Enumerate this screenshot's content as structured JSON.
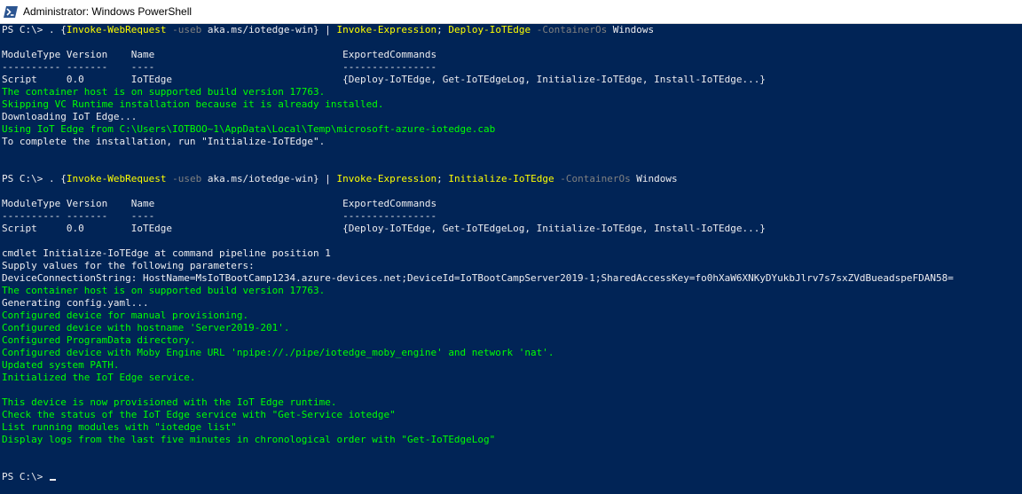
{
  "window": {
    "title": "Administrator: Windows PowerShell",
    "icon": "powershell-icon"
  },
  "colors": {
    "background": "#012456",
    "text": "#eeedf0",
    "command": "#ffff00",
    "parameter": "#808080",
    "success": "#00ff00"
  },
  "console": {
    "lines": [
      [
        {
          "t": "PS C:\\> . {"
        },
        {
          "t": "Invoke-WebRequest",
          "c": "cmd"
        },
        {
          "t": " -useb",
          "c": "param"
        },
        {
          "t": " aka.ms/iotedge-win} | "
        },
        {
          "t": "Invoke-Expression",
          "c": "cmd"
        },
        {
          "t": "; "
        },
        {
          "t": "Deploy-IoTEdge",
          "c": "cmd"
        },
        {
          "t": " -ContainerOs",
          "c": "param"
        },
        {
          "t": " Windows"
        }
      ],
      [
        {
          "t": ""
        }
      ],
      [
        {
          "t": "ModuleType Version    Name                                ExportedCommands"
        }
      ],
      [
        {
          "t": "---------- -------    ----                                ----------------"
        }
      ],
      [
        {
          "t": "Script     0.0        IoTEdge                             {Deploy-IoTEdge, Get-IoTEdgeLog, Initialize-IoTEdge, Install-IoTEdge...}"
        }
      ],
      [
        {
          "t": "The container host is on supported build version 17763.",
          "c": "ok"
        }
      ],
      [
        {
          "t": "Skipping VC Runtime installation because it is already installed.",
          "c": "ok"
        }
      ],
      [
        {
          "t": "Downloading IoT Edge..."
        }
      ],
      [
        {
          "t": "Using IoT Edge from C:\\Users\\IOTBOO~1\\AppData\\Local\\Temp\\microsoft-azure-iotedge.cab",
          "c": "ok"
        }
      ],
      [
        {
          "t": "To complete the installation, run \"Initialize-IoTEdge\"."
        }
      ],
      [
        {
          "t": ""
        }
      ],
      [
        {
          "t": ""
        }
      ],
      [
        {
          "t": "PS C:\\> . {"
        },
        {
          "t": "Invoke-WebRequest",
          "c": "cmd"
        },
        {
          "t": " -useb",
          "c": "param"
        },
        {
          "t": " aka.ms/iotedge-win} | "
        },
        {
          "t": "Invoke-Expression",
          "c": "cmd"
        },
        {
          "t": "; "
        },
        {
          "t": "Initialize-IoTEdge",
          "c": "cmd"
        },
        {
          "t": " -ContainerOs",
          "c": "param"
        },
        {
          "t": " Windows"
        }
      ],
      [
        {
          "t": ""
        }
      ],
      [
        {
          "t": "ModuleType Version    Name                                ExportedCommands"
        }
      ],
      [
        {
          "t": "---------- -------    ----                                ----------------"
        }
      ],
      [
        {
          "t": "Script     0.0        IoTEdge                             {Deploy-IoTEdge, Get-IoTEdgeLog, Initialize-IoTEdge, Install-IoTEdge...}"
        }
      ],
      [
        {
          "t": ""
        }
      ],
      [
        {
          "t": "cmdlet Initialize-IoTEdge at command pipeline position 1"
        }
      ],
      [
        {
          "t": "Supply values for the following parameters:"
        }
      ],
      [
        {
          "t": "DeviceConnectionString: HostName=MsIoTBootCamp1234.azure-devices.net;DeviceId=IoTBootCampServer2019-1;SharedAccessKey=fo0hXaW6XNKyDYukbJlrv7s7sxZVdBueadspeFDAN58="
        }
      ],
      [
        {
          "t": "The container host is on supported build version 17763.",
          "c": "ok"
        }
      ],
      [
        {
          "t": "Generating config.yaml..."
        }
      ],
      [
        {
          "t": "Configured device for manual provisioning.",
          "c": "ok"
        }
      ],
      [
        {
          "t": "Configured device with hostname 'Server2019-201'.",
          "c": "ok"
        }
      ],
      [
        {
          "t": "Configured ProgramData directory.",
          "c": "ok"
        }
      ],
      [
        {
          "t": "Configured device with Moby Engine URL 'npipe://./pipe/iotedge_moby_engine' and network 'nat'.",
          "c": "ok"
        }
      ],
      [
        {
          "t": "Updated system PATH.",
          "c": "ok"
        }
      ],
      [
        {
          "t": "Initialized the IoT Edge service.",
          "c": "ok"
        }
      ],
      [
        {
          "t": ""
        }
      ],
      [
        {
          "t": "This device is now provisioned with the IoT Edge runtime.",
          "c": "ok"
        }
      ],
      [
        {
          "t": "Check the status of the IoT Edge service with \"Get-Service iotedge\"",
          "c": "ok"
        }
      ],
      [
        {
          "t": "List running modules with \"iotedge list\"",
          "c": "ok"
        }
      ],
      [
        {
          "t": "Display logs from the last five minutes in chronological order with \"Get-IoTEdgeLog\"",
          "c": "ok"
        }
      ],
      [
        {
          "t": ""
        }
      ],
      [
        {
          "t": ""
        }
      ],
      [
        {
          "t": "PS C:\\> ",
          "cursor": true
        }
      ]
    ]
  }
}
